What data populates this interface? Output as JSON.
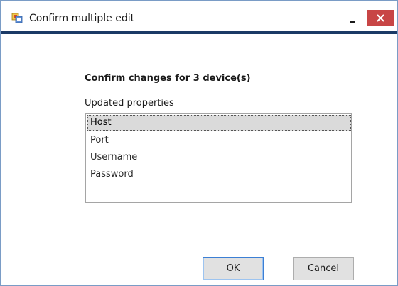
{
  "window": {
    "title": "Confirm multiple edit",
    "icon": "app-icon",
    "accent_color": "#1b3a66",
    "close_color": "#c84545"
  },
  "dialog": {
    "heading": "Confirm changes for 3 device(s)",
    "list_label": "Updated properties",
    "properties": [
      "Host",
      "Port",
      "Username",
      "Password"
    ],
    "selected_index": 0
  },
  "buttons": {
    "ok_label": "OK",
    "cancel_label": "Cancel"
  }
}
